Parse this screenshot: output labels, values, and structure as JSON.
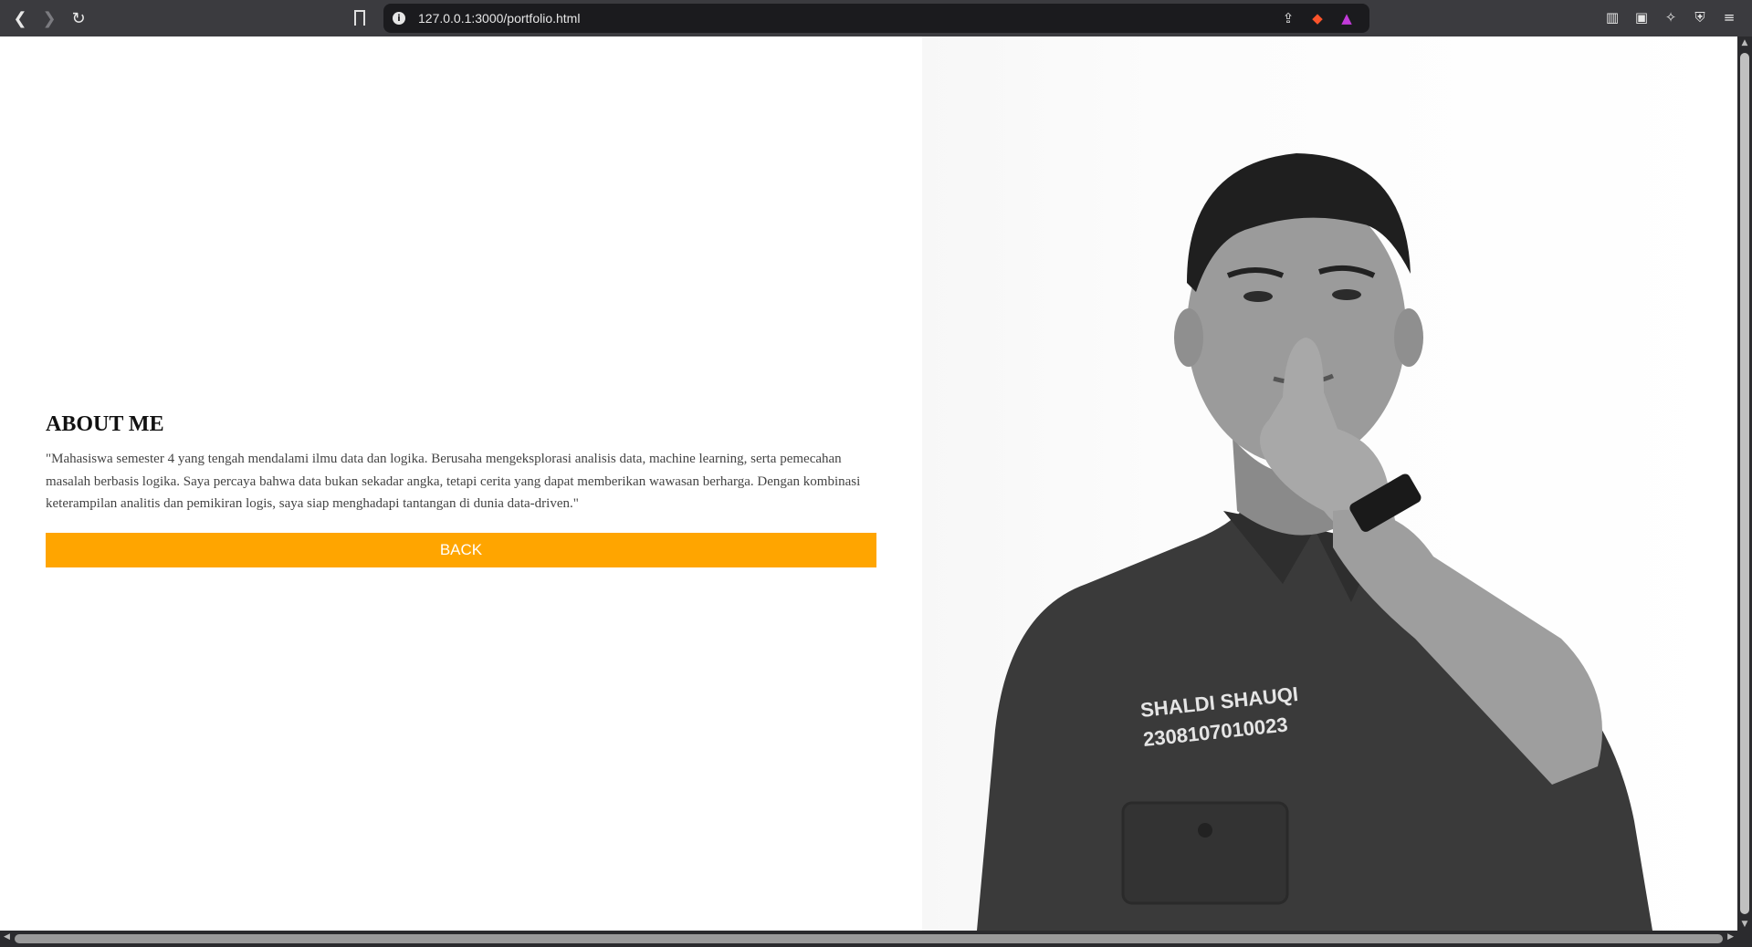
{
  "browser": {
    "url": "127.0.0.1:3000/portfolio.html",
    "back_icon": "chevron-left-icon",
    "forward_icon": "chevron-right-icon",
    "reload_icon": "reload-icon"
  },
  "about": {
    "title": "ABOUT ME",
    "text": "\"Mahasiswa semester 4 yang tengah mendalami ilmu data dan logika. Berusaha mengeksplorasi analisis data, machine learning, serta pemecahan masalah berbasis logika. Saya percaya bahwa data bukan sekadar angka, tetapi cerita yang dapat memberikan wawasan berharga. Dengan kombinasi keterampilan analitis dan pemikiran logis, saya siap menghadapi tantangan di dunia data-driven.\"",
    "back_label": "BACK"
  },
  "photo": {
    "shirt_name": "SHALDI SHAUQI",
    "shirt_id": "2308107010023"
  },
  "colors": {
    "accent": "#ffa500",
    "chrome": "#3b3b3f"
  }
}
